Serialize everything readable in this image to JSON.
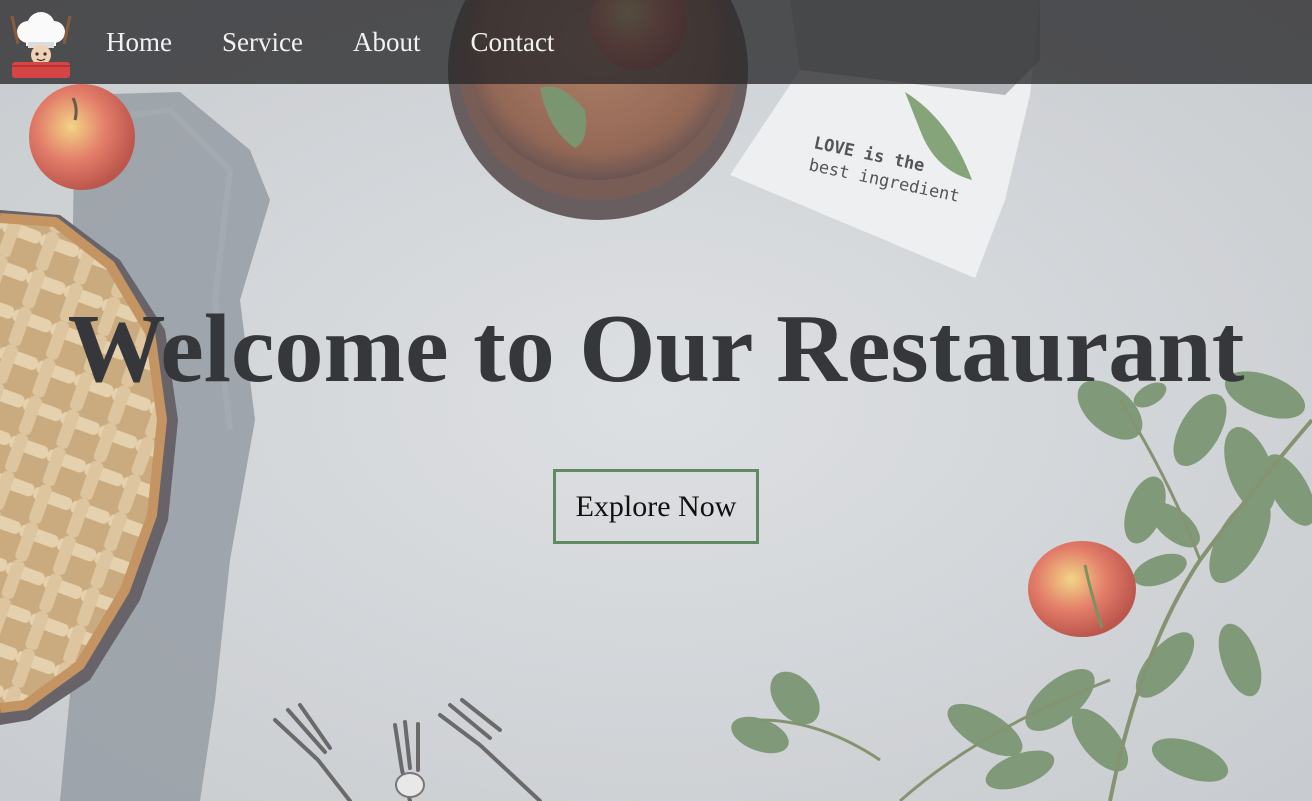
{
  "nav": {
    "logo_name": "chef-logo",
    "links": [
      {
        "label": "Home"
      },
      {
        "label": "Service"
      },
      {
        "label": "About"
      },
      {
        "label": "Contact"
      }
    ]
  },
  "hero": {
    "title": "Welcome to Our Restaurant",
    "cta_label": "Explore Now",
    "napkin_text_line1": "LOVE is the",
    "napkin_text_line2": "best ingredient"
  },
  "colors": {
    "nav_bg": "#28282a",
    "title": "#35373a",
    "cta_border": "#5f8a64",
    "nav_text": "#f2f2f2"
  }
}
